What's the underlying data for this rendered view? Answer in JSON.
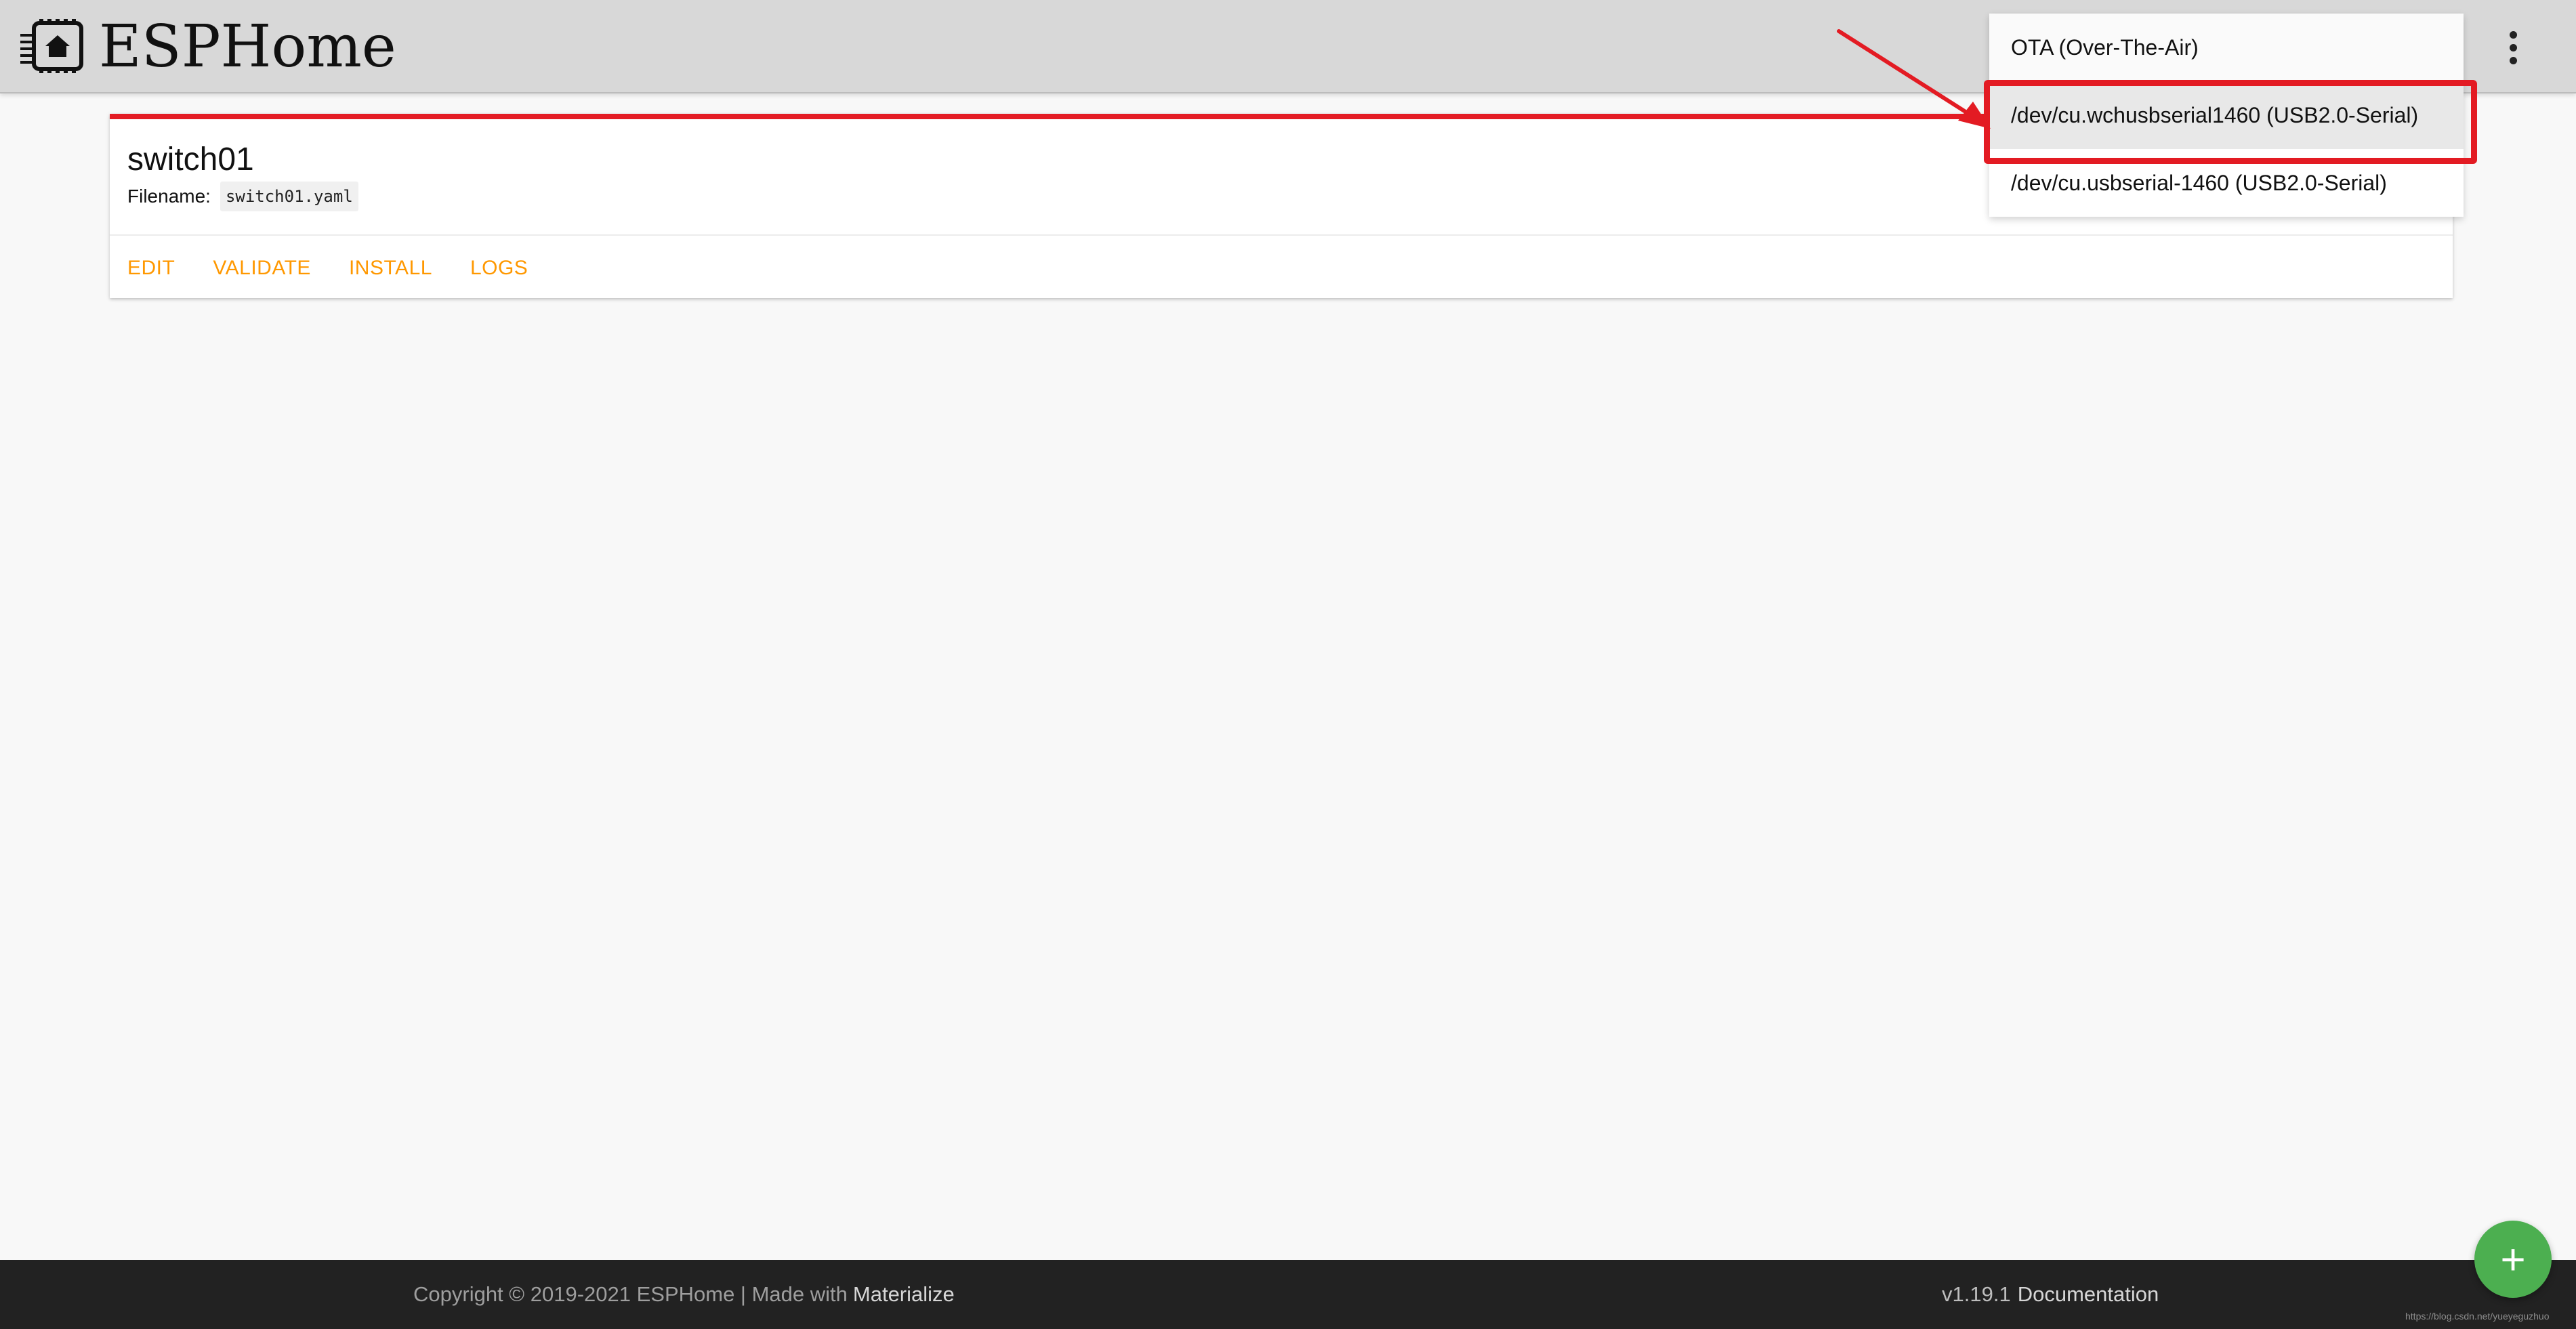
{
  "app": {
    "title": "ESPHome"
  },
  "header": {
    "logo_icon": "chip-home-icon",
    "menu_icon": "kebab-menu-icon"
  },
  "device_card": {
    "title": "switch01",
    "filename_label": "Filename:",
    "filename_value": "switch01.yaml",
    "actions": [
      "EDIT",
      "VALIDATE",
      "INSTALL",
      "LOGS"
    ]
  },
  "upload_dropdown": {
    "items": [
      {
        "label": "OTA (Over-The-Air)"
      },
      {
        "label": "/dev/cu.wchusbserial1460 (USB2.0-Serial)"
      },
      {
        "label": "/dev/cu.usbserial-1460 (USB2.0-Serial)"
      }
    ],
    "highlighted_index": 1
  },
  "footer": {
    "copyright": "Copyright © 2019-2021 ESPHome | Made with",
    "materialize_link": "Materialize",
    "version": "v1.19.1",
    "documentation_link": "Documentation"
  },
  "fab": {
    "icon": "plus-icon",
    "label": "+"
  },
  "watermark": "https://blog.csdn.net/yueyeguzhuo",
  "colors": {
    "header_bg": "#d8d8d8",
    "accent_orange": "#ff9800",
    "annotation_red": "#e31b23",
    "fab_green": "#4caf50",
    "footer_bg": "#222222"
  }
}
